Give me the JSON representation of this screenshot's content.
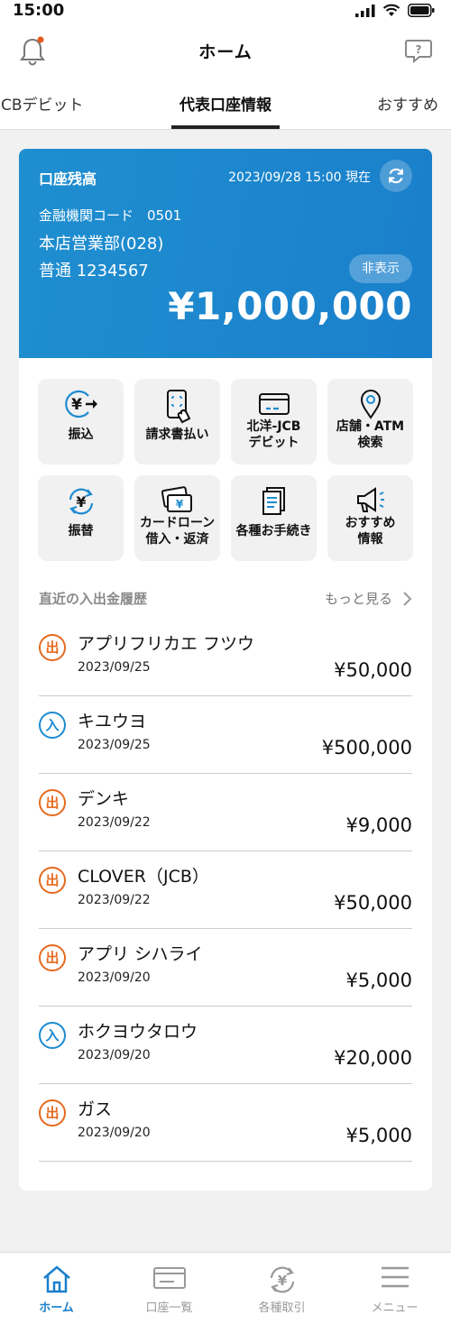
{
  "status_bar": {
    "time": "15:00"
  },
  "header": {
    "title": "ホーム",
    "notification_dot_color": "#e65a1e"
  },
  "tabs": [
    {
      "label": "JCBデビット"
    },
    {
      "label": "代表口座情報",
      "active": true
    },
    {
      "label": "おすすめ"
    }
  ],
  "balance_card": {
    "label": "口座残高",
    "as_of": "2023/09/28 15:00 現在",
    "bank_code": "金融機関コード　0501",
    "branch": "本店営業部(028)",
    "account": "普通 1234567",
    "hide_label": "非表示",
    "amount": "¥1,000,000",
    "color": "#1a7fcb"
  },
  "quick_actions": [
    {
      "label": "振込",
      "icon": "yen-transfer-icon"
    },
    {
      "label": "請求書払い",
      "icon": "phone-scan-icon"
    },
    {
      "label": "北洋-JCB\nデビット",
      "icon": "card-icon"
    },
    {
      "label": "店舗・ATM\n検索",
      "icon": "map-pin-icon"
    },
    {
      "label": "振替",
      "icon": "yen-exchange-icon"
    },
    {
      "label": "カードローン\n借入・返済",
      "icon": "cards-yen-icon"
    },
    {
      "label": "各種お手続き",
      "icon": "documents-icon"
    },
    {
      "label": "おすすめ\n情報",
      "icon": "megaphone-icon"
    }
  ],
  "history": {
    "title": "直近の入出金履歴",
    "more_label": "もっと見る",
    "out_badge": "出",
    "in_badge": "入",
    "items": [
      {
        "type": "out",
        "name": "アプリフリカエ フツウ",
        "date": "2023/09/25",
        "amount": "¥50,000"
      },
      {
        "type": "in",
        "name": "キユウヨ",
        "date": "2023/09/25",
        "amount": "¥500,000"
      },
      {
        "type": "out",
        "name": "デンキ",
        "date": "2023/09/22",
        "amount": "¥9,000"
      },
      {
        "type": "out",
        "name": "CLOVER（JCB）",
        "date": "2023/09/22",
        "amount": "¥50,000"
      },
      {
        "type": "out",
        "name": "アプリ シハライ",
        "date": "2023/09/20",
        "amount": "¥5,000"
      },
      {
        "type": "in",
        "name": "ホクヨウタロウ",
        "date": "2023/09/20",
        "amount": "¥20,000"
      },
      {
        "type": "out",
        "name": "ガス",
        "date": "2023/09/20",
        "amount": "¥5,000"
      }
    ]
  },
  "bottom_nav": [
    {
      "label": "ホーム",
      "icon": "home-icon",
      "active": true
    },
    {
      "label": "口座一覧",
      "icon": "account-list-icon"
    },
    {
      "label": "各種取引",
      "icon": "transactions-icon"
    },
    {
      "label": "メニュー",
      "icon": "menu-icon"
    }
  ]
}
